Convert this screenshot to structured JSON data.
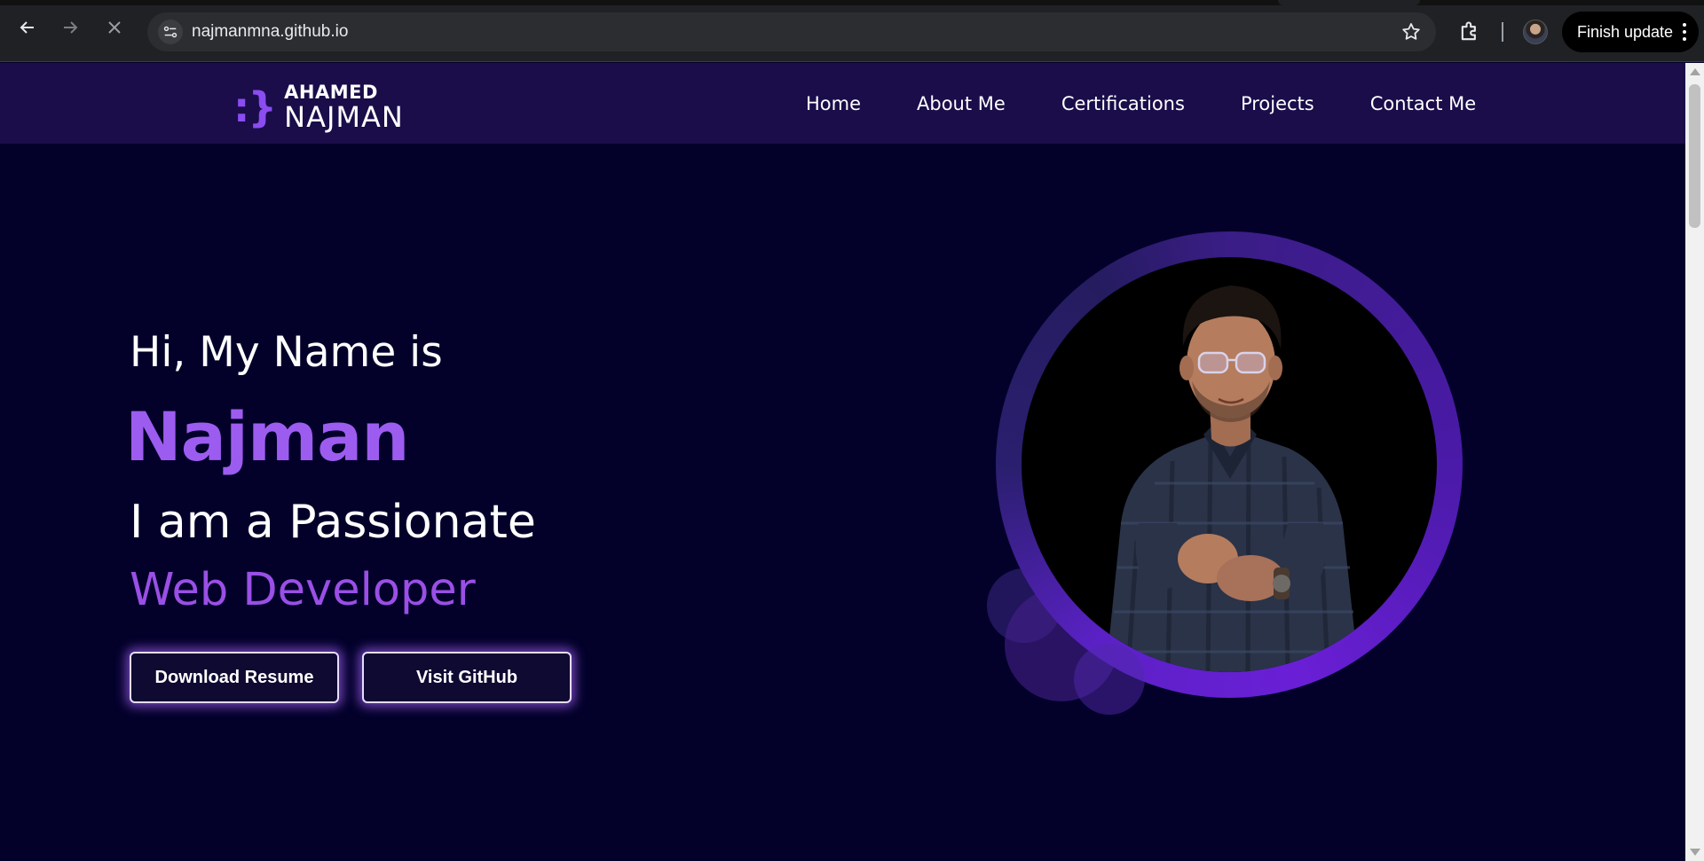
{
  "browser": {
    "url": "najmanmna.github.io",
    "update_label": "Finish update"
  },
  "site": {
    "logo": {
      "mark": ":}",
      "top": "AHAMED",
      "bottom": "NAJMAN"
    },
    "nav": [
      "Home",
      "About Me",
      "Certifications",
      "Projects",
      "Contact Me"
    ],
    "hero": {
      "greeting": "Hi, My Name is",
      "name": "Najman",
      "intro": "I am a Passionate",
      "role": "Web Developer",
      "buttons": {
        "resume": "Download Resume",
        "github": "Visit GitHub"
      }
    }
  },
  "colors": {
    "page_bg": "#03012a",
    "navbar_bg": "#1a0d4a",
    "accent": "#9d5cf0",
    "ring": "#5b21c6"
  }
}
